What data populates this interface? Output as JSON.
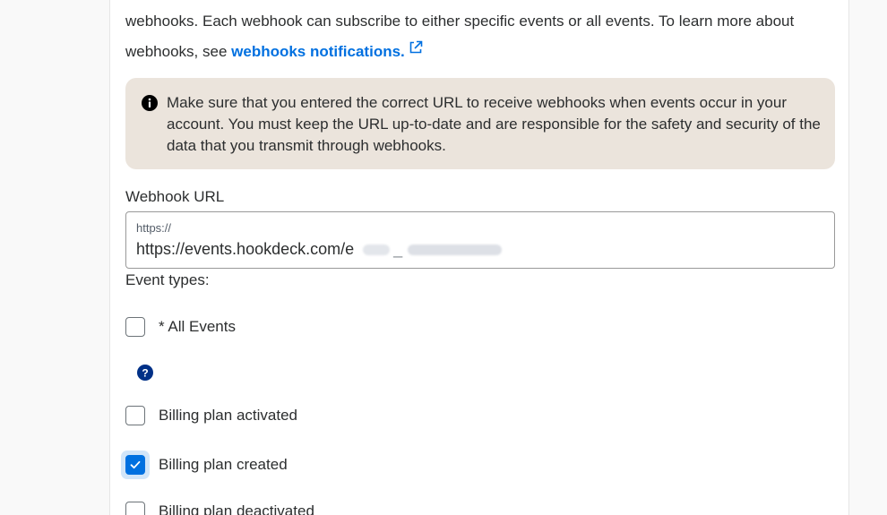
{
  "intro": {
    "line1": "webhooks. Each webhook can subscribe to either specific events or all events. To learn more about",
    "line2_prefix": "webhooks, see ",
    "link_label": "webhooks notifications."
  },
  "notice": {
    "text": "Make sure that you entered the correct URL to receive webhooks when events occur in your account. You must keep the URL up-to-date and are responsible for the safety and security of the data that you transmit through webhooks."
  },
  "webhook_url": {
    "label": "Webhook URL",
    "placeholder": "https://",
    "value_visible": "https://events.hookdeck.com/e",
    "value_separator": "_"
  },
  "event_types": {
    "label": "Event types:",
    "items": [
      {
        "label": "* All Events",
        "checked": false
      },
      {
        "label": "Billing plan activated",
        "checked": false
      },
      {
        "label": "Billing plan created",
        "checked": true
      },
      {
        "label": "Billing plan deactivated",
        "checked": false
      }
    ]
  },
  "colors": {
    "accent": "#0070e0",
    "notice_bg": "#ebe4dc",
    "help_icon": "#003087"
  },
  "icons": {
    "external_link": "external-link-icon",
    "info": "info-icon",
    "help": "help-icon",
    "check": "check-icon"
  }
}
